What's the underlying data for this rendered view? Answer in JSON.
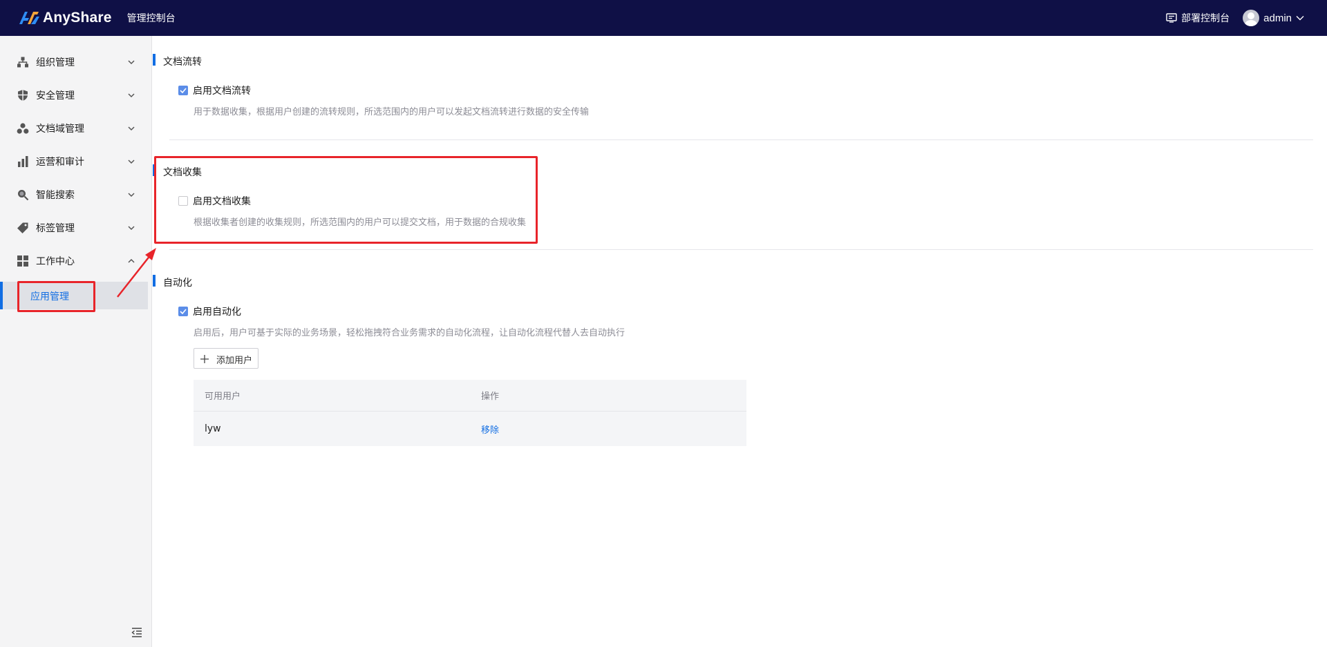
{
  "header": {
    "brand": "AnyShare",
    "console_title": "管理控制台",
    "deploy_label": "部署控制台",
    "username": "admin"
  },
  "sidebar": {
    "items": [
      {
        "label": "组织管理",
        "icon": "org-tree-icon",
        "expanded": false
      },
      {
        "label": "安全管理",
        "icon": "shield-icon",
        "expanded": false
      },
      {
        "label": "文档域管理",
        "icon": "doc-domain-icon",
        "expanded": false
      },
      {
        "label": "运营和审计",
        "icon": "bar-chart-icon",
        "expanded": false
      },
      {
        "label": "智能搜索",
        "icon": "search-icon",
        "expanded": false
      },
      {
        "label": "标签管理",
        "icon": "tag-icon",
        "expanded": false
      },
      {
        "label": "工作中心",
        "icon": "grid-icon",
        "expanded": true
      }
    ],
    "sub_item": {
      "label": "应用管理",
      "active": true
    }
  },
  "sections": {
    "flow": {
      "title": "文档流转",
      "checkbox_label": "启用文档流转",
      "checked": true,
      "description": "用于数据收集，根据用户创建的流转规则，所选范围内的用户可以发起文档流转进行数据的安全传输"
    },
    "collect": {
      "title": "文档收集",
      "checkbox_label": "启用文档收集",
      "checked": false,
      "description": "根据收集者创建的收集规则，所选范围内的用户可以提交文档，用于数据的合规收集"
    },
    "automation": {
      "title": "自动化",
      "checkbox_label": "启用自动化",
      "checked": true,
      "description": "启用后，用户可基于实际的业务场景，轻松拖拽符合业务需求的自动化流程，让自动化流程代替人去自动执行",
      "add_button": "添加用户",
      "table": {
        "columns": [
          "可用用户",
          "操作"
        ],
        "rows": [
          {
            "user": "lyw",
            "action": "移除"
          }
        ]
      }
    }
  },
  "colors": {
    "header_bg": "#0f1046",
    "accent": "#126ee3",
    "annotation_red": "#e8242a"
  }
}
